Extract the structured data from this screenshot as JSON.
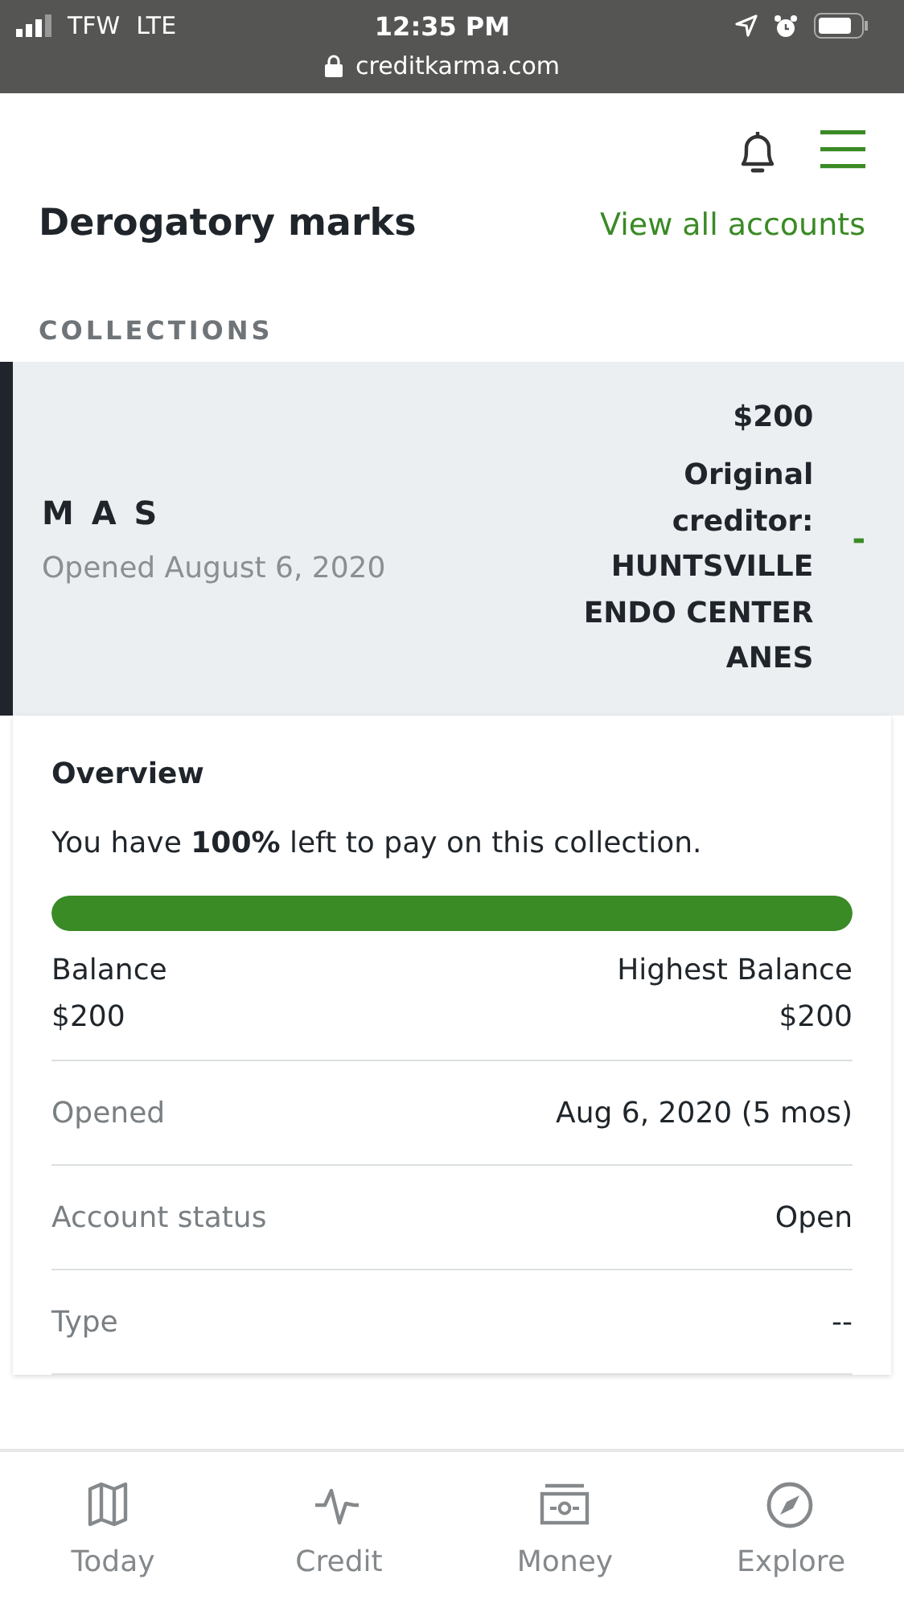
{
  "status_bar": {
    "carrier": "TFW",
    "network": "LTE",
    "time": "12:35 PM",
    "url": "creditkarma.com"
  },
  "header": {
    "title": "Derogatory marks",
    "link": "View all accounts"
  },
  "section_label": "COLLECTIONS",
  "account": {
    "name": "M A S",
    "opened": "Opened August 6, 2020",
    "amount": "$200",
    "creditor": "Original creditor: HUNTSVILLE ENDO CENTER ANES",
    "expanded": true,
    "toggle": "-"
  },
  "overview": {
    "title": "Overview",
    "sentence": "You have **100%** left to pay on this collection.",
    "level": 1,
    "balance_label": "Balance",
    "balance": "$200",
    "highest_label": "Highest Balance",
    "highest": "$200",
    "rows": [
      {
        "label": "Opened",
        "value": "Aug 6, 2020 (5 mos)"
      },
      {
        "label": "Account status",
        "value": "Open"
      },
      {
        "label": "Type",
        "value": "--"
      }
    ]
  },
  "tabs": [
    {
      "kind": "map",
      "label": "Today",
      "selected": false
    },
    {
      "kind": "pulse",
      "label": "Credit",
      "selected": false
    },
    {
      "kind": "money",
      "label": "Money",
      "selected": false
    },
    {
      "kind": "compass",
      "label": "Explore",
      "selected": false
    }
  ]
}
